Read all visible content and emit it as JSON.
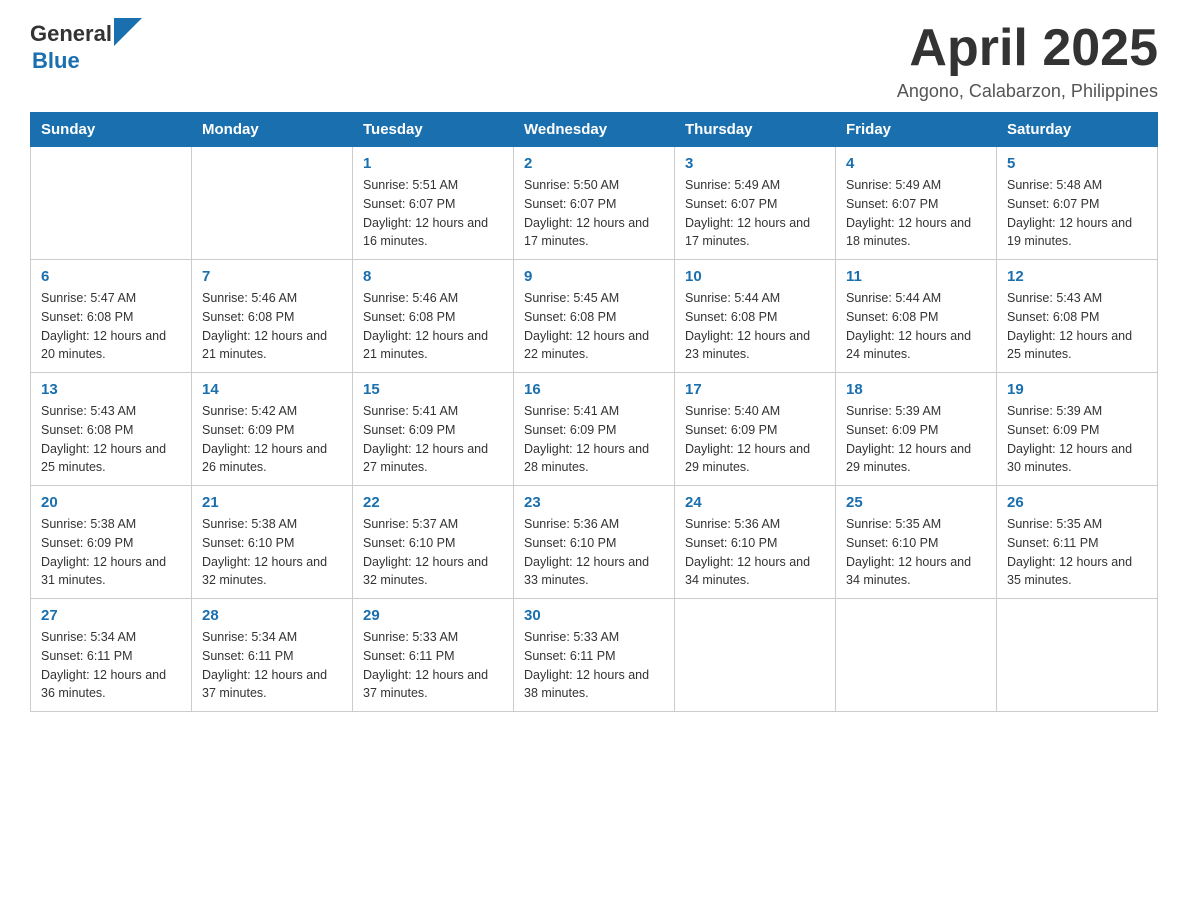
{
  "header": {
    "logo_general": "General",
    "logo_blue": "Blue",
    "title": "April 2025",
    "subtitle": "Angono, Calabarzon, Philippines"
  },
  "days_of_week": [
    "Sunday",
    "Monday",
    "Tuesday",
    "Wednesday",
    "Thursday",
    "Friday",
    "Saturday"
  ],
  "weeks": [
    [
      {
        "day": "",
        "sunrise": "",
        "sunset": "",
        "daylight": ""
      },
      {
        "day": "",
        "sunrise": "",
        "sunset": "",
        "daylight": ""
      },
      {
        "day": "1",
        "sunrise": "Sunrise: 5:51 AM",
        "sunset": "Sunset: 6:07 PM",
        "daylight": "Daylight: 12 hours and 16 minutes."
      },
      {
        "day": "2",
        "sunrise": "Sunrise: 5:50 AM",
        "sunset": "Sunset: 6:07 PM",
        "daylight": "Daylight: 12 hours and 17 minutes."
      },
      {
        "day": "3",
        "sunrise": "Sunrise: 5:49 AM",
        "sunset": "Sunset: 6:07 PM",
        "daylight": "Daylight: 12 hours and 17 minutes."
      },
      {
        "day": "4",
        "sunrise": "Sunrise: 5:49 AM",
        "sunset": "Sunset: 6:07 PM",
        "daylight": "Daylight: 12 hours and 18 minutes."
      },
      {
        "day": "5",
        "sunrise": "Sunrise: 5:48 AM",
        "sunset": "Sunset: 6:07 PM",
        "daylight": "Daylight: 12 hours and 19 minutes."
      }
    ],
    [
      {
        "day": "6",
        "sunrise": "Sunrise: 5:47 AM",
        "sunset": "Sunset: 6:08 PM",
        "daylight": "Daylight: 12 hours and 20 minutes."
      },
      {
        "day": "7",
        "sunrise": "Sunrise: 5:46 AM",
        "sunset": "Sunset: 6:08 PM",
        "daylight": "Daylight: 12 hours and 21 minutes."
      },
      {
        "day": "8",
        "sunrise": "Sunrise: 5:46 AM",
        "sunset": "Sunset: 6:08 PM",
        "daylight": "Daylight: 12 hours and 21 minutes."
      },
      {
        "day": "9",
        "sunrise": "Sunrise: 5:45 AM",
        "sunset": "Sunset: 6:08 PM",
        "daylight": "Daylight: 12 hours and 22 minutes."
      },
      {
        "day": "10",
        "sunrise": "Sunrise: 5:44 AM",
        "sunset": "Sunset: 6:08 PM",
        "daylight": "Daylight: 12 hours and 23 minutes."
      },
      {
        "day": "11",
        "sunrise": "Sunrise: 5:44 AM",
        "sunset": "Sunset: 6:08 PM",
        "daylight": "Daylight: 12 hours and 24 minutes."
      },
      {
        "day": "12",
        "sunrise": "Sunrise: 5:43 AM",
        "sunset": "Sunset: 6:08 PM",
        "daylight": "Daylight: 12 hours and 25 minutes."
      }
    ],
    [
      {
        "day": "13",
        "sunrise": "Sunrise: 5:43 AM",
        "sunset": "Sunset: 6:08 PM",
        "daylight": "Daylight: 12 hours and 25 minutes."
      },
      {
        "day": "14",
        "sunrise": "Sunrise: 5:42 AM",
        "sunset": "Sunset: 6:09 PM",
        "daylight": "Daylight: 12 hours and 26 minutes."
      },
      {
        "day": "15",
        "sunrise": "Sunrise: 5:41 AM",
        "sunset": "Sunset: 6:09 PM",
        "daylight": "Daylight: 12 hours and 27 minutes."
      },
      {
        "day": "16",
        "sunrise": "Sunrise: 5:41 AM",
        "sunset": "Sunset: 6:09 PM",
        "daylight": "Daylight: 12 hours and 28 minutes."
      },
      {
        "day": "17",
        "sunrise": "Sunrise: 5:40 AM",
        "sunset": "Sunset: 6:09 PM",
        "daylight": "Daylight: 12 hours and 29 minutes."
      },
      {
        "day": "18",
        "sunrise": "Sunrise: 5:39 AM",
        "sunset": "Sunset: 6:09 PM",
        "daylight": "Daylight: 12 hours and 29 minutes."
      },
      {
        "day": "19",
        "sunrise": "Sunrise: 5:39 AM",
        "sunset": "Sunset: 6:09 PM",
        "daylight": "Daylight: 12 hours and 30 minutes."
      }
    ],
    [
      {
        "day": "20",
        "sunrise": "Sunrise: 5:38 AM",
        "sunset": "Sunset: 6:09 PM",
        "daylight": "Daylight: 12 hours and 31 minutes."
      },
      {
        "day": "21",
        "sunrise": "Sunrise: 5:38 AM",
        "sunset": "Sunset: 6:10 PM",
        "daylight": "Daylight: 12 hours and 32 minutes."
      },
      {
        "day": "22",
        "sunrise": "Sunrise: 5:37 AM",
        "sunset": "Sunset: 6:10 PM",
        "daylight": "Daylight: 12 hours and 32 minutes."
      },
      {
        "day": "23",
        "sunrise": "Sunrise: 5:36 AM",
        "sunset": "Sunset: 6:10 PM",
        "daylight": "Daylight: 12 hours and 33 minutes."
      },
      {
        "day": "24",
        "sunrise": "Sunrise: 5:36 AM",
        "sunset": "Sunset: 6:10 PM",
        "daylight": "Daylight: 12 hours and 34 minutes."
      },
      {
        "day": "25",
        "sunrise": "Sunrise: 5:35 AM",
        "sunset": "Sunset: 6:10 PM",
        "daylight": "Daylight: 12 hours and 34 minutes."
      },
      {
        "day": "26",
        "sunrise": "Sunrise: 5:35 AM",
        "sunset": "Sunset: 6:11 PM",
        "daylight": "Daylight: 12 hours and 35 minutes."
      }
    ],
    [
      {
        "day": "27",
        "sunrise": "Sunrise: 5:34 AM",
        "sunset": "Sunset: 6:11 PM",
        "daylight": "Daylight: 12 hours and 36 minutes."
      },
      {
        "day": "28",
        "sunrise": "Sunrise: 5:34 AM",
        "sunset": "Sunset: 6:11 PM",
        "daylight": "Daylight: 12 hours and 37 minutes."
      },
      {
        "day": "29",
        "sunrise": "Sunrise: 5:33 AM",
        "sunset": "Sunset: 6:11 PM",
        "daylight": "Daylight: 12 hours and 37 minutes."
      },
      {
        "day": "30",
        "sunrise": "Sunrise: 5:33 AM",
        "sunset": "Sunset: 6:11 PM",
        "daylight": "Daylight: 12 hours and 38 minutes."
      },
      {
        "day": "",
        "sunrise": "",
        "sunset": "",
        "daylight": ""
      },
      {
        "day": "",
        "sunrise": "",
        "sunset": "",
        "daylight": ""
      },
      {
        "day": "",
        "sunrise": "",
        "sunset": "",
        "daylight": ""
      }
    ]
  ]
}
